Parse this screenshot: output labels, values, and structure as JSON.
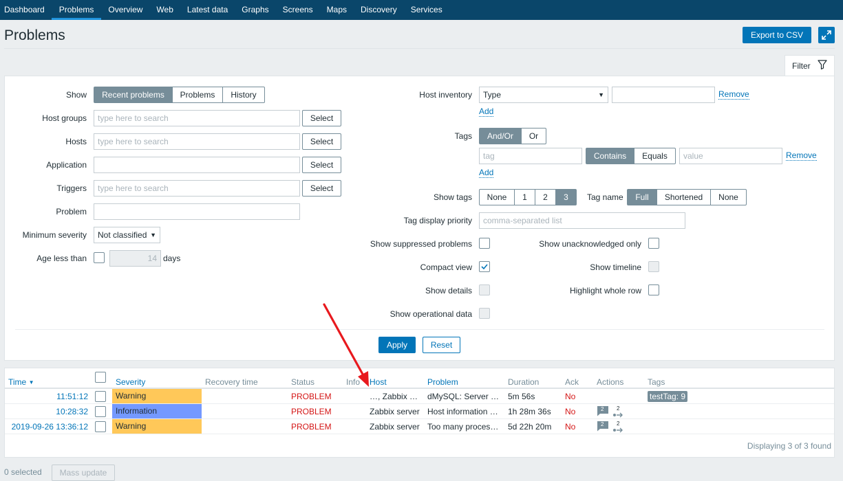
{
  "nav": {
    "items": [
      {
        "label": "Dashboard"
      },
      {
        "label": "Problems",
        "active": true
      },
      {
        "label": "Overview"
      },
      {
        "label": "Web"
      },
      {
        "label": "Latest data"
      },
      {
        "label": "Graphs"
      },
      {
        "label": "Screens"
      },
      {
        "label": "Maps"
      },
      {
        "label": "Discovery"
      },
      {
        "label": "Services"
      }
    ]
  },
  "page": {
    "title": "Problems",
    "export_label": "Export to CSV",
    "fullscreen_icon": "fullscreen-icon"
  },
  "filter": {
    "tab_label": "Filter",
    "show": {
      "label": "Show",
      "options": [
        "Recent problems",
        "Problems",
        "History"
      ],
      "selected": "Recent problems"
    },
    "host_groups": {
      "label": "Host groups",
      "placeholder": "type here to search",
      "button": "Select"
    },
    "hosts": {
      "label": "Hosts",
      "placeholder": "type here to search",
      "button": "Select"
    },
    "application": {
      "label": "Application",
      "value": "",
      "button": "Select"
    },
    "triggers": {
      "label": "Triggers",
      "placeholder": "type here to search",
      "button": "Select"
    },
    "problem": {
      "label": "Problem",
      "value": ""
    },
    "min_severity": {
      "label": "Minimum severity",
      "value": "Not classified"
    },
    "age": {
      "label": "Age less than",
      "value": "14",
      "unit": "days"
    },
    "host_inventory": {
      "label": "Host inventory",
      "type_value": "Type",
      "remove": "Remove",
      "add": "Add"
    },
    "tags": {
      "label": "Tags",
      "logic": [
        "And/Or",
        "Or"
      ],
      "tag_placeholder": "tag",
      "ops": [
        "Contains",
        "Equals"
      ],
      "value_placeholder": "value",
      "remove": "Remove",
      "add": "Add"
    },
    "show_tags": {
      "label": "Show tags",
      "options": [
        "None",
        "1",
        "2",
        "3"
      ],
      "selected": "3"
    },
    "tag_name": {
      "label": "Tag name",
      "options": [
        "Full",
        "Shortened",
        "None"
      ],
      "selected": "Full"
    },
    "tag_priority": {
      "label": "Tag display priority",
      "placeholder": "comma-separated list"
    },
    "show_suppressed": {
      "label": "Show suppressed problems",
      "checked": false
    },
    "show_unack": {
      "label": "Show unacknowledged only",
      "checked": false
    },
    "compact_view": {
      "label": "Compact view",
      "checked": true
    },
    "show_timeline": {
      "label": "Show timeline",
      "checked": false
    },
    "show_details": {
      "label": "Show details",
      "checked": false
    },
    "highlight_row": {
      "label": "Highlight whole row",
      "checked": false
    },
    "show_opdata": {
      "label": "Show operational data",
      "checked": false
    },
    "apply": "Apply",
    "reset": "Reset"
  },
  "table": {
    "headers": {
      "time": "Time",
      "severity": "Severity",
      "recovery": "Recovery time",
      "status": "Status",
      "info": "Info",
      "host": "Host",
      "problem": "Problem",
      "duration": "Duration",
      "ack": "Ack",
      "actions": "Actions",
      "tags": "Tags"
    },
    "rows": [
      {
        "time": "11:51:12",
        "severity": "Warning",
        "severity_color": "#ffc859",
        "status": "PROBLEM",
        "host_prefix": "…",
        "host": "Zabbix …",
        "problem": "dMySQL: Server …",
        "duration": "5m 56s",
        "ack": "No",
        "tag": "testTag: 9"
      },
      {
        "time": "10:28:32",
        "severity": "Information",
        "severity_color": "#7499ff",
        "status": "PROBLEM",
        "host": "Zabbix server",
        "problem": "Host information …",
        "duration": "1h 28m 36s",
        "ack": "No",
        "msg_count": "2",
        "action_count": "2"
      },
      {
        "time": "2019-09-26 13:36:12",
        "severity": "Warning",
        "severity_color": "#ffc859",
        "status": "PROBLEM",
        "host": "Zabbix server",
        "problem": "Too many proces…",
        "duration": "5d 22h 20m",
        "ack": "No",
        "msg_count": "2",
        "action_count": "2"
      }
    ],
    "footer": "Displaying 3 of 3 found"
  },
  "bottom": {
    "selected": "0 selected",
    "mass_update": "Mass update"
  },
  "annotation": {
    "arrow_color": "#e8191e"
  }
}
